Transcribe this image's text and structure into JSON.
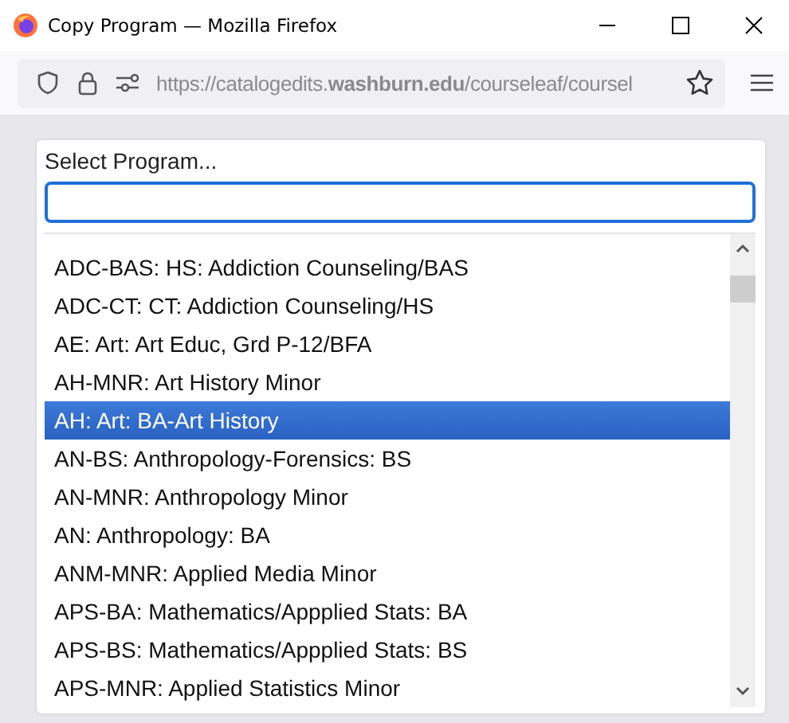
{
  "window": {
    "title": "Copy Program — Mozilla Firefox"
  },
  "address_bar": {
    "url": "https://catalogedits.**washburn.edu**/courseleaf/coursel"
  },
  "dialog": {
    "label": "Select Program...",
    "options": [
      {
        "label": "ADC-BAS: HS: Addiction Counseling/BAS",
        "selected": false
      },
      {
        "label": "ADC-CT: CT: Addiction Counseling/HS",
        "selected": false
      },
      {
        "label": "AE: Art: Art Educ, Grd P-12/BFA",
        "selected": false
      },
      {
        "label": "AH-MNR: Art History Minor",
        "selected": false
      },
      {
        "label": "AH: Art: BA-Art History",
        "selected": true
      },
      {
        "label": "AN-BS: Anthropology-Forensics: BS",
        "selected": false
      },
      {
        "label": "AN-MNR: Anthropology Minor",
        "selected": false
      },
      {
        "label": "AN: Anthropology: BA",
        "selected": false
      },
      {
        "label": "ANM-MNR: Applied Media Minor",
        "selected": false
      },
      {
        "label": "APS-BA: Mathematics/Appplied Stats: BA",
        "selected": false
      },
      {
        "label": "APS-BS: Mathematics/Appplied Stats: BS",
        "selected": false
      },
      {
        "label": "APS-MNR: Applied Statistics Minor",
        "selected": false
      }
    ]
  }
}
